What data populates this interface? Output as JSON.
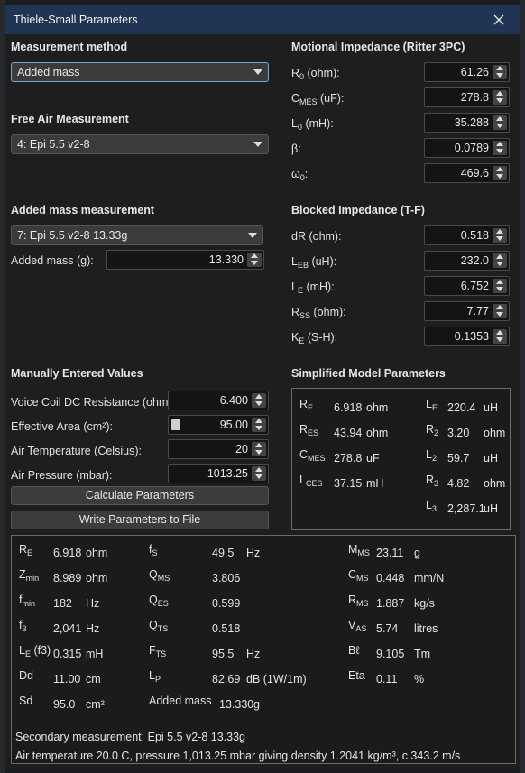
{
  "window": {
    "title": "Thiele-Small Parameters"
  },
  "measurement_method": {
    "heading": "Measurement method",
    "selected": "Added mass"
  },
  "free_air": {
    "heading": "Free Air Measurement",
    "selected": "4: Epi 5.5 v2-8"
  },
  "added_mass_meas": {
    "heading": "Added mass measurement",
    "selected": "7: Epi 5.5 v2-8 13.33g",
    "mass_label": "Added mass (g):",
    "mass_value": "13.330"
  },
  "manual": {
    "heading": "Manually Entered Values",
    "fields": [
      {
        "label": "Voice Coil DC Resistance (ohm):",
        "value": "6.400"
      },
      {
        "label": "Effective Area (cm²):",
        "value": "95.00"
      },
      {
        "label": "Air Temperature (Celsius):",
        "value": "20"
      },
      {
        "label": "Air Pressure (mbar):",
        "value": "1013.25"
      }
    ],
    "calc_button": "Calculate Parameters",
    "write_button": "Write Parameters to File"
  },
  "motional": {
    "heading": "Motional Impedance (Ritter 3PC)",
    "fields": [
      {
        "sym": "R",
        "sub": "0",
        "unit": " (ohm):",
        "value": "61.26"
      },
      {
        "sym": "C",
        "sub": "MES",
        "unit": " (uF):",
        "value": "278.8"
      },
      {
        "sym": "L",
        "sub": "0",
        "unit": " (mH):",
        "value": "35.288"
      },
      {
        "sym": "β:",
        "sub": "",
        "unit": "",
        "value": "0.0789"
      },
      {
        "sym": "ω",
        "sub": "0",
        "unit": ":",
        "value": "469.6"
      }
    ]
  },
  "blocked": {
    "heading": "Blocked Impedance (T-F)",
    "fields": [
      {
        "sym": "dR (ohm):",
        "sub": "",
        "unit": "",
        "value": "0.518"
      },
      {
        "sym": "L",
        "sub": "EB",
        "unit": " (uH):",
        "value": "232.0"
      },
      {
        "sym": "L",
        "sub": "E",
        "unit": " (mH):",
        "value": "6.752"
      },
      {
        "sym": "R",
        "sub": "SS",
        "unit": " (ohm):",
        "value": "7.77"
      },
      {
        "sym": "K",
        "sub": "E",
        "unit": " (S-H):",
        "value": "0.1353"
      }
    ]
  },
  "simplified": {
    "heading": "Simplified Model Parameters",
    "left": [
      {
        "sym": "R",
        "sub": "E",
        "value": "6.918",
        "unit": "ohm"
      },
      {
        "sym": "R",
        "sub": "ES",
        "value": "43.94",
        "unit": "ohm"
      },
      {
        "sym": "C",
        "sub": "MES",
        "value": "278.8",
        "unit": "uF"
      },
      {
        "sym": "L",
        "sub": "CES",
        "value": "37.15",
        "unit": "mH"
      }
    ],
    "right": [
      {
        "sym": "L",
        "sub": "E",
        "value": "220.4",
        "unit": "uH"
      },
      {
        "sym": "R",
        "sub": "2",
        "value": "3.20",
        "unit": "ohm"
      },
      {
        "sym": "L",
        "sub": "2",
        "value": "59.7",
        "unit": "uH"
      },
      {
        "sym": "R",
        "sub": "3",
        "value": "4.82",
        "unit": "ohm"
      },
      {
        "sym": "L",
        "sub": "3",
        "value": "2,287.1",
        "unit": "uH"
      }
    ]
  },
  "results": {
    "col1": [
      {
        "sym": "R",
        "sub": "E",
        "value": "6.918",
        "unit": "ohm"
      },
      {
        "sym": "Z",
        "sub": "min",
        "value": "8.989",
        "unit": "ohm"
      },
      {
        "sym": "f",
        "sub": "min",
        "value": "182",
        "unit": "Hz"
      },
      {
        "sym": "f",
        "sub": "3",
        "value": "2,041",
        "unit": "Hz"
      },
      {
        "sym": "L",
        "sub": "E",
        "extra": " (f3)",
        "value": "0.315",
        "unit": "mH"
      },
      {
        "sym": "Dd",
        "sub": "",
        "value": "11.00",
        "unit": "cm"
      },
      {
        "sym": "Sd",
        "sub": "",
        "value": "95.0",
        "unit": "cm²"
      }
    ],
    "col2": [
      {
        "sym": "f",
        "sub": "S",
        "value": "49.5",
        "unit": "Hz"
      },
      {
        "sym": "Q",
        "sub": "MS",
        "value": "3.806",
        "unit": ""
      },
      {
        "sym": "Q",
        "sub": "ES",
        "value": "0.599",
        "unit": ""
      },
      {
        "sym": "Q",
        "sub": "TS",
        "value": "0.518",
        "unit": ""
      },
      {
        "sym": "F",
        "sub": "TS",
        "value": "95.5",
        "unit": "Hz"
      },
      {
        "sym": "L",
        "sub": "P",
        "value": "82.69",
        "unit": "dB (1W/1m)"
      },
      {
        "sym": "Added mass",
        "sub": "",
        "value": "13.330",
        "unit": "g"
      }
    ],
    "col3": [
      {
        "sym": "M",
        "sub": "MS",
        "value": "23.11",
        "unit": "g"
      },
      {
        "sym": "C",
        "sub": "MS",
        "value": "0.448",
        "unit": "mm/N"
      },
      {
        "sym": "R",
        "sub": "MS",
        "value": "1.887",
        "unit": "kg/s"
      },
      {
        "sym": "V",
        "sub": "AS",
        "value": "5.74",
        "unit": "litres"
      },
      {
        "sym": "Bℓ",
        "sub": "",
        "value": "9.105",
        "unit": "Tm"
      },
      {
        "sym": "Eta",
        "sub": "",
        "value": "0.11",
        "unit": "%"
      }
    ],
    "secondary": "Secondary measurement: Epi 5.5 v2-8 13.33g",
    "air": "Air temperature 20.0 C, pressure 1,013.25 mbar giving density 1.2041 kg/m³, c 343.2 m/s"
  }
}
